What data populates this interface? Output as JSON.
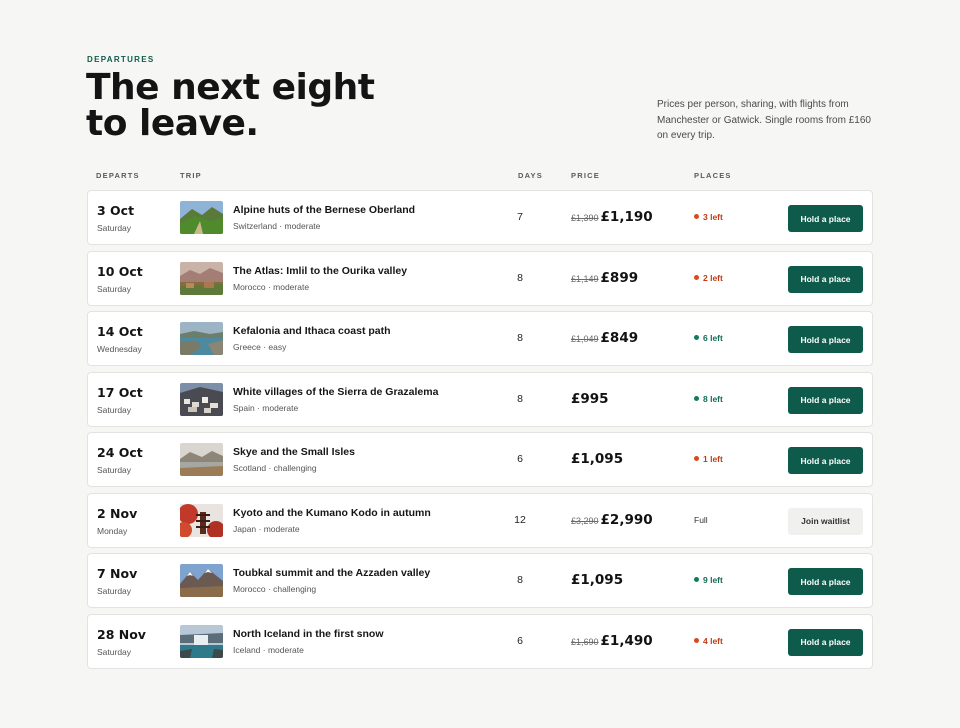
{
  "header": {
    "eyebrow": "DEPARTURES",
    "title": "The next eight to leave.",
    "intro": "Prices per person, sharing, with flights from Manchester or Gatwick. Single rooms from £160 on every trip."
  },
  "columns": {
    "departs": "DEPARTS",
    "trip": "TRIP",
    "days": "DAYS",
    "price": "PRICE",
    "places": "PLACES"
  },
  "colors": {
    "accent": "#0e5b4b",
    "low_places": "#c03a14",
    "ok_places": "#126b55",
    "background": "#f6f6f5"
  },
  "departures": [
    {
      "date": "3 Oct",
      "weekday": "Saturday",
      "title": "Alpine huts of the Bernese Oberland",
      "meta": "Switzerland · moderate",
      "days": "7",
      "was": "£1,390",
      "price": "£1,190",
      "places": "3 left",
      "status": "low",
      "action": "Hold a place",
      "image": "alpine-meadow-photo"
    },
    {
      "date": "10 Oct",
      "weekday": "Saturday",
      "title": "The Atlas: Imlil to the Ourika valley",
      "meta": "Morocco · moderate",
      "days": "8",
      "was": "£1,149",
      "price": "£899",
      "places": "2 left",
      "status": "low",
      "action": "Hold a place",
      "image": "atlas-valley-photo"
    },
    {
      "date": "14 Oct",
      "weekday": "Wednesday",
      "title": "Kefalonia and Ithaca coast path",
      "meta": "Greece · easy",
      "days": "8",
      "was": "£1,049",
      "price": "£849",
      "places": "6 left",
      "status": "ok",
      "action": "Hold a place",
      "image": "greek-coast-photo"
    },
    {
      "date": "17 Oct",
      "weekday": "Saturday",
      "title": "White villages of the Sierra de Grazalema",
      "meta": "Spain · moderate",
      "days": "8",
      "was": "",
      "price": "£995",
      "places": "8 left",
      "status": "ok",
      "action": "Hold a place",
      "image": "white-village-photo"
    },
    {
      "date": "24 Oct",
      "weekday": "Saturday",
      "title": "Skye and the Small Isles",
      "meta": "Scotland · challenging",
      "days": "6",
      "was": "",
      "price": "£1,095",
      "places": "1 left",
      "status": "low",
      "action": "Hold a place",
      "image": "skye-loch-photo"
    },
    {
      "date": "2 Nov",
      "weekday": "Monday",
      "title": "Kyoto and the Kumano Kodo in autumn",
      "meta": "Japan · moderate",
      "days": "12",
      "was": "£3,290",
      "price": "£2,990",
      "places": "Full",
      "status": "full",
      "action": "Join waitlist",
      "image": "kyoto-pagoda-photo"
    },
    {
      "date": "7 Nov",
      "weekday": "Saturday",
      "title": "Toubkal summit and the Azzaden valley",
      "meta": "Morocco · challenging",
      "days": "8",
      "was": "",
      "price": "£1,095",
      "places": "9 left",
      "status": "ok",
      "action": "Hold a place",
      "image": "snowy-peaks-photo"
    },
    {
      "date": "28 Nov",
      "weekday": "Saturday",
      "title": "North Iceland in the first snow",
      "meta": "Iceland · moderate",
      "days": "6",
      "was": "£1,690",
      "price": "£1,490",
      "places": "4 left",
      "status": "low",
      "action": "Hold a place",
      "image": "iceland-waterfall-photo"
    }
  ]
}
